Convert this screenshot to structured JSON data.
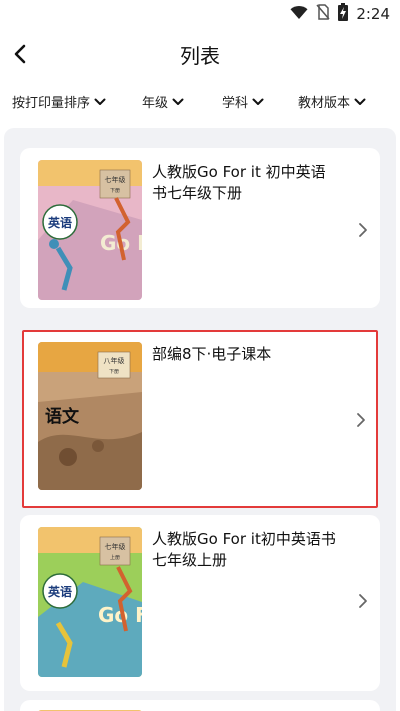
{
  "status_bar": {
    "time": "2:24",
    "icons": [
      "wifi-icon",
      "no-sim-icon",
      "battery-charging-icon"
    ]
  },
  "header": {
    "title": "列表",
    "back_icon": "chevron-left-icon"
  },
  "filters": [
    {
      "label": "按打印量排序"
    },
    {
      "label": "年级"
    },
    {
      "label": "学科"
    },
    {
      "label": "教材版本"
    }
  ],
  "books": [
    {
      "title": "人教版Go For it 初中英语书七年级下册",
      "cover": {
        "subject": "英语",
        "grade": "七年级",
        "volume": "下册",
        "brand": "Go For it!"
      },
      "selected": false
    },
    {
      "title": "部编8下·电子课本",
      "cover": {
        "subject": "语文",
        "grade": "八年级",
        "volume": "下册"
      },
      "selected": true
    },
    {
      "title": "人教版Go For it初中英语书七年级上册",
      "cover": {
        "subject": "英语",
        "grade": "七年级",
        "volume": "上册",
        "brand": "Go For it!"
      },
      "selected": false
    }
  ],
  "colors": {
    "accent_selected_border": "#e33a3a",
    "list_background": "#f1f2f5"
  }
}
